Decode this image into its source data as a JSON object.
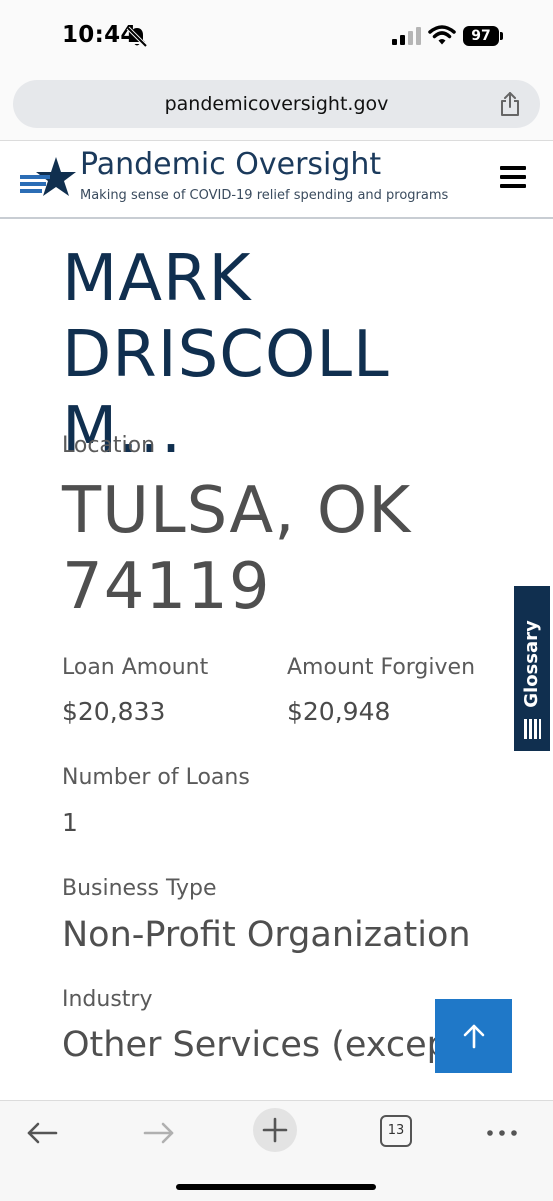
{
  "status_bar": {
    "time": "10:44",
    "battery": "97"
  },
  "browser": {
    "url": "pandemicoversight.gov",
    "tab_count": "13"
  },
  "site": {
    "brand_prefix": "Pandemic",
    "brand_suffix": "Oversight",
    "tagline": "Making sense of COVID-19 relief spending and programs"
  },
  "recipient": {
    "name": "MARK DRISCOLL M...",
    "location_label": "Location",
    "location": "TULSA, OK 74119",
    "loan_amount_label": "Loan Amount",
    "loan_amount": "$20,833",
    "amount_forgiven_label": "Amount Forgiven",
    "amount_forgiven": "$20,948",
    "number_of_loans_label": "Number of Loans",
    "number_of_loans": "1",
    "business_type_label": "Business Type",
    "business_type": "Non-Profit Organization",
    "industry_label": "Industry",
    "industry": "Other Services (except"
  },
  "glossary": {
    "label": "Glossary"
  },
  "colors": {
    "brand_navy": "#102f4f",
    "accent_blue": "#1f78c8"
  },
  "icons": {
    "bell": "bell-slash-icon",
    "signal": "cellular-signal-icon",
    "wifi": "wifi-icon",
    "share": "share-icon",
    "logo": "star-logo-icon",
    "menu": "hamburger-menu-icon",
    "glossary": "list-icon",
    "back_to_top": "arrow-up-icon",
    "back": "arrow-left-icon",
    "forward": "arrow-right-icon",
    "new_tab": "plus-icon",
    "more": "more-dots-icon"
  }
}
